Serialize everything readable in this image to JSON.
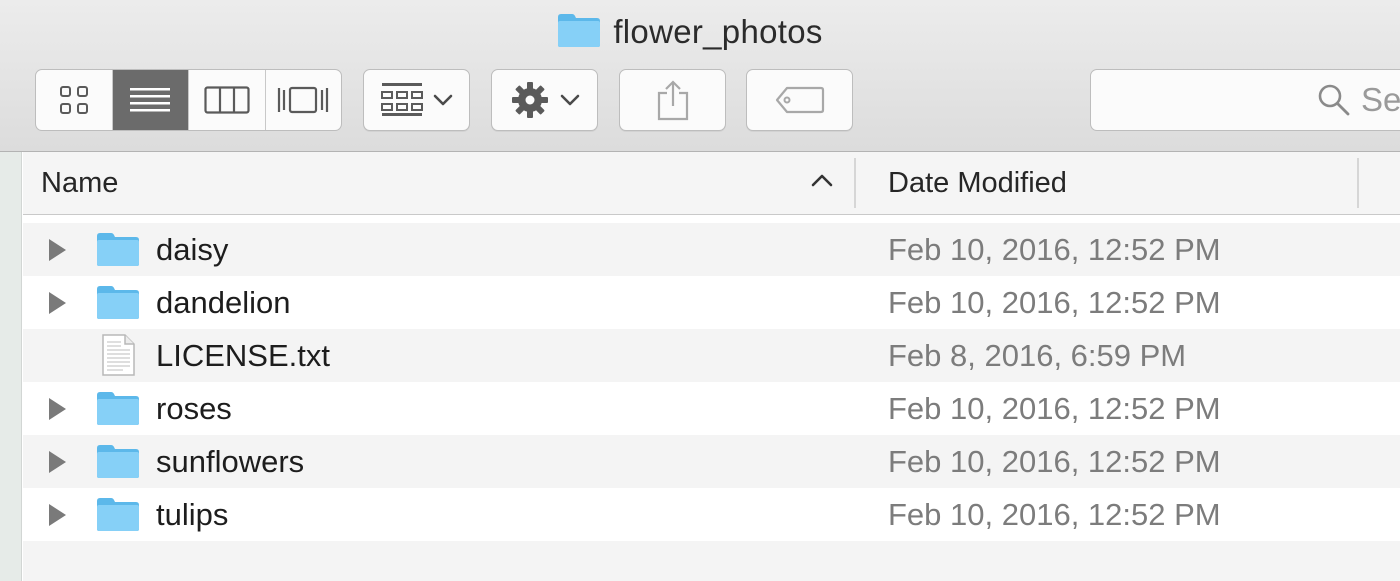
{
  "window": {
    "title": "flower_photos"
  },
  "toolbar": {
    "view_modes": [
      {
        "name": "icon-view",
        "icon": "grid-icon",
        "active": false
      },
      {
        "name": "list-view",
        "icon": "list-icon",
        "active": true
      },
      {
        "name": "column-view",
        "icon": "columns-icon",
        "active": false
      },
      {
        "name": "cover-flow-view",
        "icon": "cover-flow-icon",
        "active": false
      }
    ],
    "arrange_icon": "arrange-icon",
    "action_icon": "gear-icon",
    "share_icon": "share-icon",
    "tag_icon": "tag-icon",
    "search": {
      "icon": "search-icon",
      "visible_text": "Se"
    }
  },
  "columns": {
    "name": "Name",
    "date_modified": "Date Modified",
    "sort": "ascending"
  },
  "files": [
    {
      "name": "daisy",
      "type": "folder",
      "date": "Feb 10, 2016, 12:52 PM"
    },
    {
      "name": "dandelion",
      "type": "folder",
      "date": "Feb 10, 2016, 12:52 PM"
    },
    {
      "name": "LICENSE.txt",
      "type": "file",
      "date": "Feb 8, 2016, 6:59 PM"
    },
    {
      "name": "roses",
      "type": "folder",
      "date": "Feb 10, 2016, 12:52 PM"
    },
    {
      "name": "sunflowers",
      "type": "folder",
      "date": "Feb 10, 2016, 12:52 PM"
    },
    {
      "name": "tulips",
      "type": "folder",
      "date": "Feb 10, 2016, 12:52 PM"
    }
  ],
  "colors": {
    "folder": "#7cccf5",
    "folder_tab": "#5cb8ea",
    "active_segment": "#6b6b6b"
  }
}
